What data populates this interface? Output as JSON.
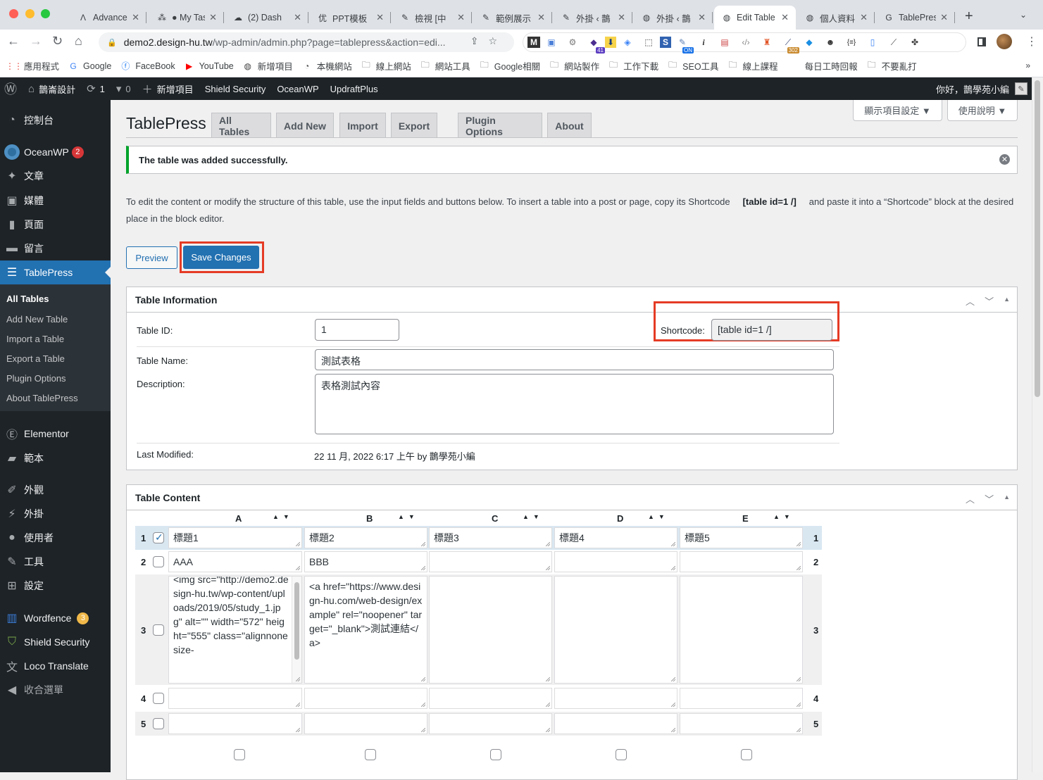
{
  "browser": {
    "tabs": [
      {
        "icon": "advanced-icon",
        "glyph": "Λ",
        "title": "Advanced",
        "active": false
      },
      {
        "icon": "asana-icon",
        "glyph": "⁂",
        "title": "● My Tas",
        "active": false
      },
      {
        "icon": "cloud-icon",
        "glyph": "☁",
        "title": "(2) Dash",
        "active": false
      },
      {
        "icon": "ppt-icon",
        "glyph": "优",
        "title": "PPT模板",
        "active": false
      },
      {
        "icon": "clip-icon",
        "glyph": "✎",
        "title": "檢視 [中",
        "active": false
      },
      {
        "icon": "clip-icon",
        "glyph": "✎",
        "title": "範例展示",
        "active": false
      },
      {
        "icon": "clip-icon",
        "glyph": "✎",
        "title": "外掛 ‹ 鵲",
        "active": false
      },
      {
        "icon": "globe-icon",
        "glyph": "◍",
        "title": "外掛 ‹ 鵲",
        "active": false
      },
      {
        "icon": "globe-icon",
        "glyph": "◍",
        "title": "Edit Table",
        "active": true
      },
      {
        "icon": "globe-icon",
        "glyph": "◍",
        "title": "個人資料",
        "active": false
      },
      {
        "icon": "google-icon",
        "glyph": "G",
        "title": "TablePress",
        "active": false
      }
    ],
    "url_host": "demo2.design-hu.tw",
    "url_path": "/wp-admin/admin.php?page=tablepress&action=edi...",
    "extension_badges": {
      "b1": "41",
      "b2": "ON",
      "b3": "302"
    },
    "bookmarks": [
      {
        "icon": "apps-grid-icon",
        "label": "應用程式"
      },
      {
        "icon": "google-icon",
        "label": "Google"
      },
      {
        "icon": "facebook-icon",
        "label": "FaceBook"
      },
      {
        "icon": "youtube-icon",
        "label": "YouTube"
      },
      {
        "icon": "globe-icon",
        "label": "新增項目"
      },
      {
        "icon": "local-icon",
        "label": "本機網站"
      },
      {
        "icon": "folder-icon",
        "label": "線上網站"
      },
      {
        "icon": "folder-icon",
        "label": "網站工具"
      },
      {
        "icon": "folder-icon",
        "label": "Google相關"
      },
      {
        "icon": "folder-icon",
        "label": "網站製作"
      },
      {
        "icon": "folder-icon",
        "label": "工作下載"
      },
      {
        "icon": "folder-icon",
        "label": "SEO工具"
      },
      {
        "icon": "folder-icon",
        "label": "線上課程"
      },
      {
        "icon": "none",
        "label": "每日工時回報"
      },
      {
        "icon": "folder-icon",
        "label": "不要亂打"
      }
    ],
    "more": "»"
  },
  "adminbar": {
    "site_name": "鵲崙設計",
    "updates": "1",
    "comments": "0",
    "new_item": "新增項目",
    "links": [
      "Shield Security",
      "OceanWP",
      "UpdraftPlus"
    ],
    "greeting": "你好，鵲學苑小編"
  },
  "sidebar": {
    "items": [
      {
        "icon": "dashboard-icon",
        "label": "控制台"
      },
      {
        "icon": "oceanwp-icon",
        "label": "OceanWP",
        "badge": "2"
      },
      {
        "icon": "pin-icon",
        "label": "文章"
      },
      {
        "icon": "media-icon",
        "label": "媒體"
      },
      {
        "icon": "page-icon",
        "label": "頁面"
      },
      {
        "icon": "comment-icon",
        "label": "留言"
      },
      {
        "icon": "table-icon",
        "label": "TablePress",
        "active": true
      },
      {
        "icon": "elementor-icon",
        "label": "Elementor"
      },
      {
        "icon": "folder-open-icon",
        "label": "範本"
      },
      {
        "icon": "brush-icon",
        "label": "外觀"
      },
      {
        "icon": "plugin-icon",
        "label": "外掛"
      },
      {
        "icon": "user-icon",
        "label": "使用者"
      },
      {
        "icon": "wrench-icon",
        "label": "工具"
      },
      {
        "icon": "settings-icon",
        "label": "設定"
      },
      {
        "icon": "wordfence-icon",
        "label": "Wordfence",
        "badge": "3"
      },
      {
        "icon": "shield-icon",
        "label": "Shield Security"
      },
      {
        "icon": "translate-icon",
        "label": "Loco Translate"
      },
      {
        "icon": "collapse-icon",
        "label": "收合選單"
      }
    ],
    "submenu": [
      "All Tables",
      "Add New Table",
      "Import a Table",
      "Export a Table",
      "Plugin Options",
      "About TablePress"
    ]
  },
  "page": {
    "screen_options": "顯示項目設定 ▼",
    "help": "使用說明 ▼",
    "title": "TablePress",
    "nav_tabs": [
      "All Tables",
      "Add New",
      "Import",
      "Export",
      "Plugin Options",
      "About"
    ],
    "notice": "The table was added successfully.",
    "intro_before": "To edit the content or modify the structure of this table, use the input fields and buttons below. To insert a table into a post or page, copy its Shortcode",
    "intro_shortcode": "[table id=1 /]",
    "intro_after": "and paste it into a “Shortcode” block at the desired place in the block editor.",
    "preview_label": "Preview",
    "save_label": "Save Changes"
  },
  "table_info": {
    "heading": "Table Information",
    "id_label": "Table ID:",
    "id_value": "1",
    "shortcode_label": "Shortcode:",
    "shortcode_value": "[table id=1 /]",
    "name_label": "Table Name:",
    "name_value": "測試表格",
    "desc_label": "Description:",
    "desc_value": "表格測試內容",
    "modified_label": "Last Modified:",
    "modified_value": "22 11 月, 2022 6:17 上午 by 鵲學苑小編"
  },
  "table_content": {
    "heading": "Table Content",
    "columns": [
      "A",
      "B",
      "C",
      "D",
      "E"
    ],
    "rows": [
      {
        "num": "1",
        "checked": true,
        "cells": [
          "標題1",
          "標題2",
          "標題3",
          "標題4",
          "標題5"
        ]
      },
      {
        "num": "2",
        "checked": false,
        "cells": [
          "AAA",
          "BBB",
          "",
          "",
          ""
        ]
      },
      {
        "num": "3",
        "checked": false,
        "cells": [
          "<img src=\"http://demo2.design-hu.tw/wp-content/uploads/2019/05/study_1.jpg\" alt=\"\" width=\"572\" height=\"555\" class=\"alignnone size-",
          "<a href=\"https://www.design-hu.com/web-design/example\" rel=\"noopener\" target=\"_blank\">測試連結</a>",
          "",
          "",
          ""
        ]
      },
      {
        "num": "4",
        "checked": false,
        "cells": [
          "",
          "",
          "",
          "",
          ""
        ]
      },
      {
        "num": "5",
        "checked": false,
        "cells": [
          "",
          "",
          "",
          "",
          ""
        ]
      }
    ]
  }
}
